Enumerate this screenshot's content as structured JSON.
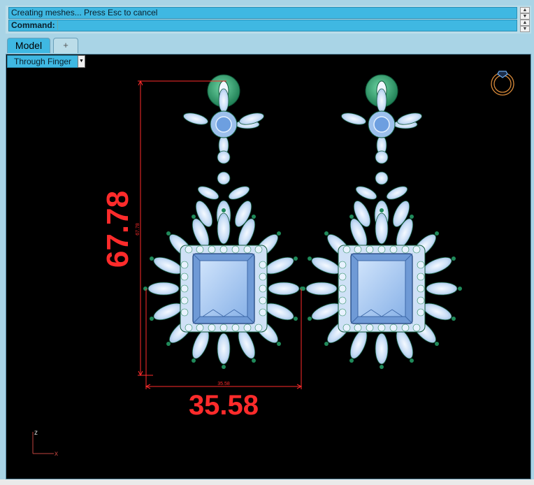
{
  "command_history": "Creating meshes... Press Esc to cancel",
  "command_prompt": "Command:",
  "command_value": "",
  "tabs": {
    "model": "Model",
    "add": "+"
  },
  "viewport": {
    "title": "Through Finger",
    "dropdown_symbol": "▼",
    "height_dimension": "67.78",
    "width_dimension": "35.58",
    "height_small_label": "67.78",
    "width_small_label": "35.58",
    "axis_z": "z",
    "axis_x": "x"
  },
  "colors": {
    "viewport_background": "#000000",
    "dimension_red": "#ff2b2b",
    "command_bar_blue": "#3fb8e2",
    "marquise_stone": "#c8ddf5",
    "center_stone": "#8fb8ea",
    "emerald_green": "#2f9e6b"
  },
  "icons": {
    "ring_icon": "ring-widget-icon"
  }
}
